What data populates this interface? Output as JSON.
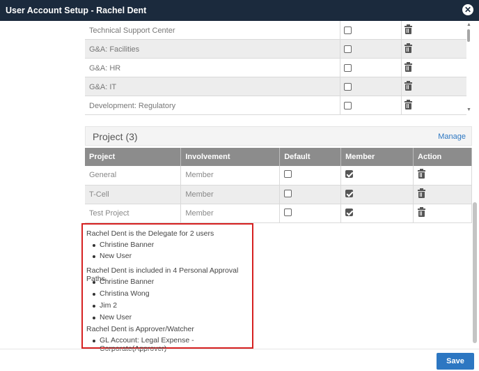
{
  "window": {
    "title": "User Account Setup - Rachel Dent"
  },
  "departments": [
    {
      "name": "Technical Support Center",
      "checked": false
    },
    {
      "name": "G&A: Facilities",
      "checked": false
    },
    {
      "name": "G&A: HR",
      "checked": false
    },
    {
      "name": "G&A: IT",
      "checked": false
    },
    {
      "name": "Development: Regulatory",
      "checked": false
    }
  ],
  "project": {
    "title": "Project (3)",
    "manage_label": "Manage",
    "columns": [
      "Project",
      "Involvement",
      "Default",
      "Member",
      "Action"
    ],
    "rows": [
      {
        "project": "General",
        "involvement": "Member",
        "default": false,
        "member": true
      },
      {
        "project": "T-Cell",
        "involvement": "Member",
        "default": false,
        "member": true
      },
      {
        "project": "Test Project",
        "involvement": "Member",
        "default": false,
        "member": true
      }
    ]
  },
  "info": {
    "delegate_heading": "Rachel Dent is the Delegate for 2 users",
    "delegate_users": [
      "Christine Banner",
      "New User"
    ],
    "approval_heading": "Rachel Dent is included in 4 Personal Approval Paths",
    "approval_users": [
      "Christine Banner",
      "Christina Wong",
      "Jim 2",
      "New User"
    ],
    "approver_heading": "Rachel Dent is Approver/Watcher",
    "approver_items": [
      "GL Account: Legal Expense - Corporate(Approver)"
    ]
  },
  "footer": {
    "save_label": "Save"
  },
  "colors": {
    "titlebar": "#1b2a3d",
    "accent": "#2d77c2",
    "highlight_border": "#d62020",
    "table_header": "#8c8c8c"
  }
}
